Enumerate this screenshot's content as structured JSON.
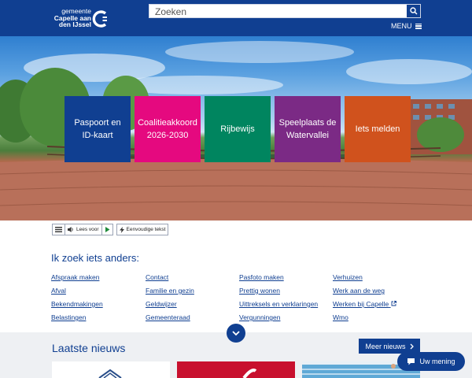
{
  "header": {
    "logo_lines": [
      "gemeente",
      "Capelle aan",
      "den IJssel"
    ],
    "search_placeholder": "Zoeken",
    "menu_label": "MENU"
  },
  "tiles": [
    {
      "label": "Paspoort en ID-kaart",
      "color": "#103f91"
    },
    {
      "label": "Coalitieakkoord 2026-2030",
      "color": "#e5097f"
    },
    {
      "label": "Rijbewijs",
      "color": "#00855f"
    },
    {
      "label": "Speelplaats de Watervallei",
      "color": "#7b2a85"
    },
    {
      "label": "Iets melden",
      "color": "#d0521d"
    }
  ],
  "tools": {
    "read_label": "Lees voor",
    "simple_text_label": "Eenvoudige tekst"
  },
  "search_other": {
    "title": "Ik zoek iets anders:",
    "columns": [
      [
        "Afspraak maken",
        "Afval",
        "Bekendmakingen",
        "Belastingen"
      ],
      [
        "Contact",
        "Familie en gezin",
        "Geldwijzer",
        "Gemeenteraad"
      ],
      [
        "Pasfoto maken",
        "Prettig wonen",
        "Uittreksels en verklaringen",
        "Vergunningen"
      ],
      [
        "Verhuizen",
        "Werk aan de weg",
        "Werken bij Capelle",
        "Wmo"
      ]
    ]
  },
  "news": {
    "title": "Laatste nieuws",
    "more_label": "Meer nieuws"
  },
  "feedback_label": "Uw mening",
  "colors": {
    "brand_blue": "#103f91",
    "news_bg": "#eef0f3"
  }
}
